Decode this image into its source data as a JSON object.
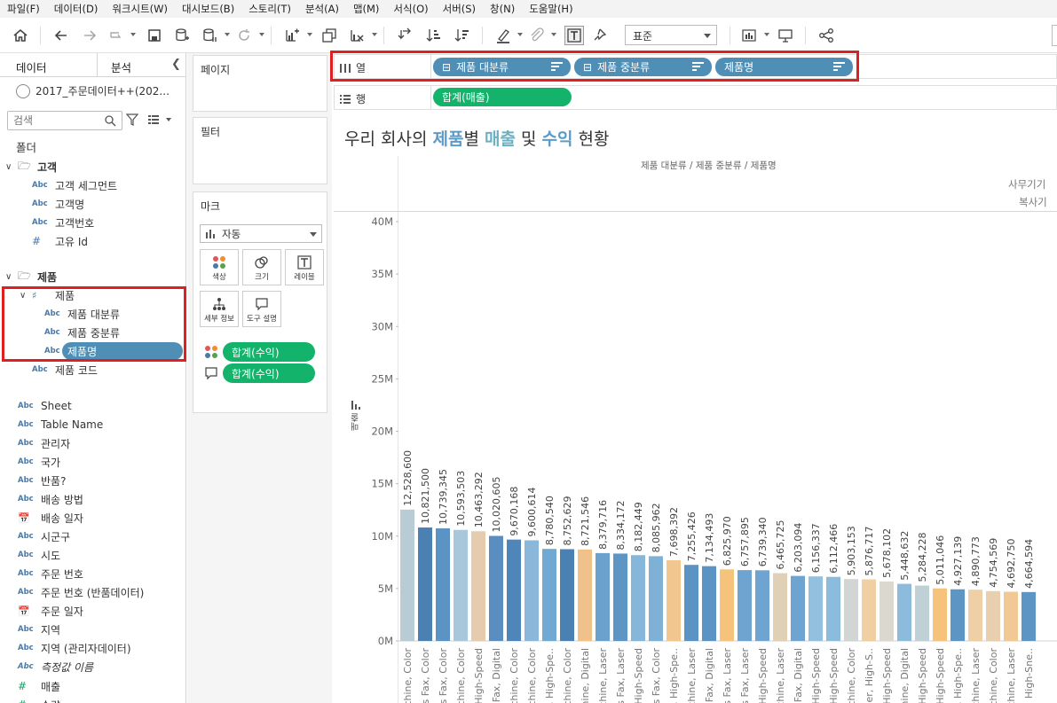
{
  "menu": [
    "파일(F)",
    "데이터(D)",
    "워크시트(W)",
    "대시보드(B)",
    "스토리(T)",
    "분석(A)",
    "맵(M)",
    "서식(O)",
    "서버(S)",
    "창(N)",
    "도움말(H)"
  ],
  "toolbar": {
    "standard_select": "표준"
  },
  "data_pane": {
    "tab_data": "데이터",
    "tab_analysis": "분석",
    "datasource": "2017_주문데이터++(202...",
    "search_placeholder": "검색",
    "folder_header": "폴더",
    "group_customer": "고객",
    "customer_fields": [
      "고객 세그먼트",
      "고객명",
      "고객번호",
      "고유 Id"
    ],
    "group_product": "제품",
    "hierarchy": "제품",
    "hierarchy_fields": [
      "제품 대분류",
      "제품 중분류",
      "제품명"
    ],
    "product_code": "제품 코드",
    "other_fields": [
      "Sheet",
      "Table Name",
      "관리자",
      "국가",
      "반품?",
      "배송 방법",
      "배송 일자",
      "시군구",
      "시도",
      "주문 번호",
      "주문 번호 (반품데이터)",
      "주문 일자",
      "지역",
      "지역 (관리자데이터)",
      "측정값 이름",
      "매출",
      "수량"
    ]
  },
  "shelves": {
    "pages_title": "페이지",
    "filters_title": "필터",
    "marks_title": "마크",
    "mark_type": "자동",
    "mark_buttons": [
      "색상",
      "크기",
      "레이블",
      "세부 정보",
      "도구 설명"
    ],
    "color_pill": "합계(수익)",
    "tooltip_pill": "합계(수익)",
    "columns_label": "열",
    "rows_label": "행",
    "column_pills": [
      "제품 대분류",
      "제품 중분류",
      "제품명"
    ],
    "row_pill": "합계(매출)"
  },
  "viz": {
    "title_parts": [
      "우리 회사의 ",
      "제품",
      "별 ",
      "매출",
      " 및 ",
      "수익",
      " 현황"
    ],
    "header_label": "제품 대분류 / 제품 중분류 / 제품명",
    "header_cat1": "사무기기",
    "header_cat2": "복사기"
  },
  "chart_data": {
    "type": "bar",
    "ylabel": "매출",
    "ylim": [
      0,
      40000000
    ],
    "y_ticks": [
      "0M",
      "5M",
      "10M",
      "15M",
      "20M",
      "25M",
      "30M",
      "35M",
      "40M"
    ],
    "x_labels_visible": [
      "chine, Color",
      "s Fax, Color",
      "s Fax, Color",
      "chine, Color",
      "High-Speed",
      "Fax, Digital",
      "chine, Color",
      "chine, Color",
      ", High-Spe..",
      "chine, Color",
      "nine, Digital",
      "chine, Laser",
      "s Fax, Laser",
      "High-Speed",
      "s Fax, Color",
      ", High-Spe..",
      "chine, Laser",
      "Fax, Digital",
      "s Fax, Laser",
      "s Fax, Laser",
      "High-Speed",
      "chine, Laser",
      "Fax, Digital",
      "High-Speed",
      "High-Speed",
      "chine, Color",
      "ier, High-S..",
      "High-Speed",
      "nine, Digital",
      "High-Speed",
      "High-Speed",
      ", High-Spe..",
      "chine, Laser",
      "chine, Color",
      "chine, Laser",
      "High-Sne.."
    ],
    "values": [
      12528600,
      10821500,
      10739345,
      10593503,
      10463292,
      10020605,
      9670168,
      9600614,
      8780540,
      8752629,
      8721546,
      8379716,
      8334172,
      8182449,
      8085962,
      7698392,
      7255426,
      7134493,
      6825970,
      6757895,
      6739340,
      6465725,
      6203094,
      6156337,
      6112466,
      5903153,
      5876717,
      5678102,
      5448632,
      5284228,
      5011046,
      4927139,
      4890773,
      4754569,
      4692750,
      4664594
    ],
    "data_labels": [
      "12,528,600",
      "10,821,500",
      "10,739,345",
      "10,593,503",
      "10,463,292",
      "10,020,605",
      "9,670,168",
      "9,600,614",
      "8,780,540",
      "8,752,629",
      "8,721,546",
      "8,379,716",
      "8,334,172",
      "8,182,449",
      "8,085,962",
      "7,698,392",
      "7,255,426",
      "7,134,493",
      "6,825,970",
      "6,757,895",
      "6,739,340",
      "6,465,725",
      "6,203,094",
      "6,156,337",
      "6,112,466",
      "5,903,153",
      "5,876,717",
      "5,678,102",
      "5,448,632",
      "5,284,228",
      "5,011,046",
      "4,927,139",
      "4,890,773",
      "4,754,569",
      "4,692,750",
      "4,664,594"
    ],
    "bar_colors": [
      "#b9cbd5",
      "#4b80b3",
      "#5b93c4",
      "#a9c7db",
      "#e5ccae",
      "#5a8ec0",
      "#4f86ba",
      "#8bb8da",
      "#72a9d3",
      "#4b80b3",
      "#f0c18a",
      "#6aa1cd",
      "#5d95c5",
      "#86b6d9",
      "#7fb1d7",
      "#f2c78f",
      "#5b93c4",
      "#5b93c4",
      "#f5c37c",
      "#6ea4cf",
      "#6ea4cf",
      "#dfd0b6",
      "#6ea4cf",
      "#93c0df",
      "#8bbbdd",
      "#d1d5d3",
      "#f0cfa2",
      "#dad8cf",
      "#8dbbdb",
      "#bfd0d6",
      "#f5c37c",
      "#5d95c5",
      "#efcfa5",
      "#e7cfb0",
      "#f2c994",
      "#5d95c5",
      "#5d95c5"
    ]
  }
}
